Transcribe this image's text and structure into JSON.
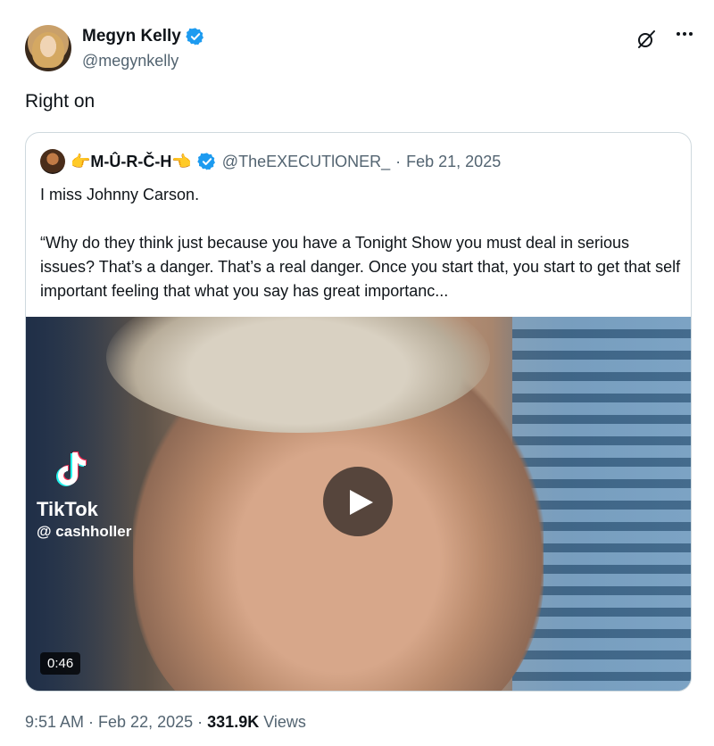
{
  "author": {
    "display_name": "Megyn Kelly",
    "handle": "@megynkelly",
    "verified_color": "#1d9bf0"
  },
  "tweet": {
    "text": "Right on",
    "timestamp": "9:51 AM · Feb 22, 2025",
    "separator": "·",
    "views_count": "331.9K",
    "views_label": "Views"
  },
  "quote": {
    "display_name": "👉M-Û-R-Č-H👈",
    "handle": "@TheEXECUTlONER_",
    "dot": "·",
    "date": "Feb 21, 2025",
    "line1": "I miss Johnny Carson.",
    "line2": "“Why do they think just because you have a Tonight Show you must deal in serious issues? That’s a danger. That’s a real danger. Once you start that, you start to get that self important feeling that what you say has great importanc...",
    "media": {
      "watermark_name": "TikTok",
      "watermark_user": "@ cashholler",
      "duration": "0:46"
    }
  },
  "icons": {
    "grok": "grok-icon",
    "more": "more-icon",
    "play": "play-icon",
    "verified": "verified-badge-icon"
  }
}
